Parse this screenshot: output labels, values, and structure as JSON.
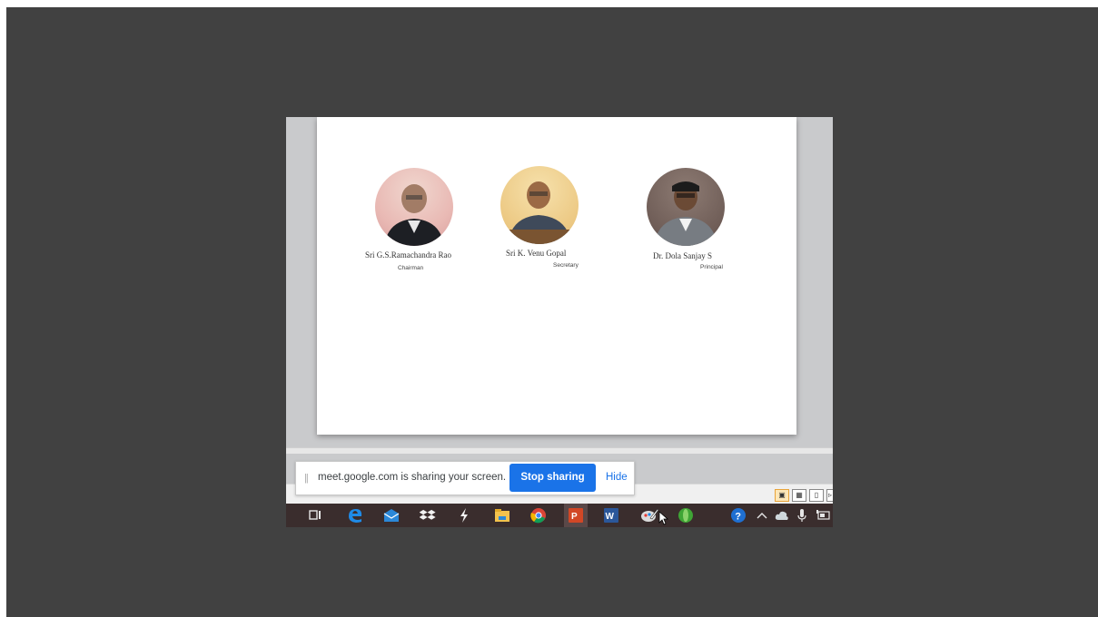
{
  "people": [
    {
      "name": "Sri G.S.Ramachandra Rao",
      "role": "Chairman"
    },
    {
      "name": "Sri K. Venu Gopal",
      "role": "Secretary"
    },
    {
      "name": "Dr. Dola Sanjay S",
      "role": "Principal"
    }
  ],
  "share_bar": {
    "grip": "||",
    "message": "meet.google.com is sharing your screen.",
    "stop_label": "Stop sharing",
    "hide_label": "Hide"
  },
  "colors": {
    "stage_bg": "#414141",
    "stop_button": "#1a73e8",
    "taskbar": "#3a2d2d"
  },
  "taskbar_icons": [
    "task-view-icon",
    "edge-icon",
    "mail-icon",
    "dropbox-icon",
    "slack-icon",
    "file-explorer-icon",
    "chrome-icon",
    "powerpoint-icon",
    "word-icon",
    "paint-icon",
    "green-app-icon",
    "help-icon",
    "chevron-up-icon",
    "cloud-icon",
    "microphone-icon",
    "battery-icon"
  ]
}
